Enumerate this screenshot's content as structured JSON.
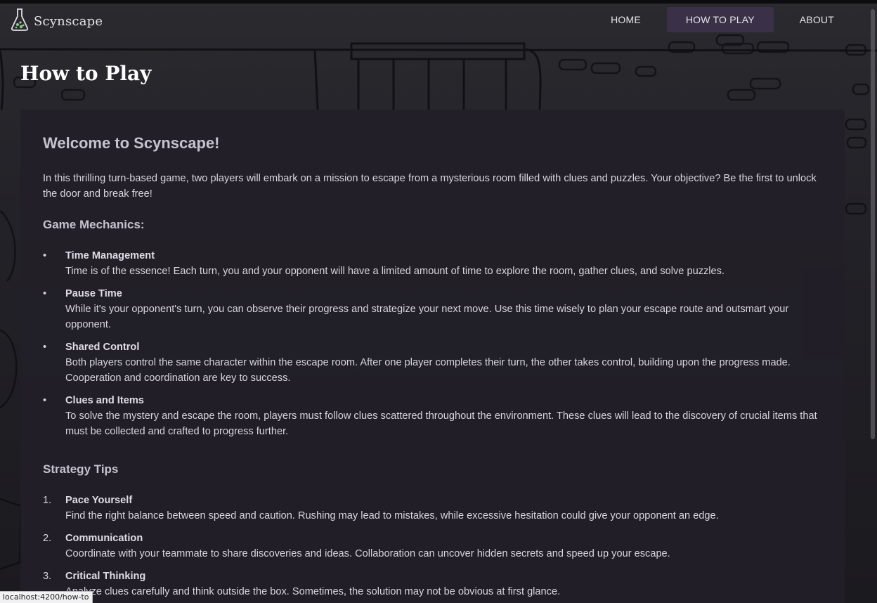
{
  "brand": {
    "name": "Scynscape",
    "icon": "flask-icon"
  },
  "nav": {
    "home": "HOME",
    "how_to_play": "HOW TO PLAY",
    "about": "ABOUT"
  },
  "page": {
    "title": "How to Play"
  },
  "content": {
    "heading": "Welcome to Scynscape!",
    "intro": "In this thrilling turn-based game, two players will embark on a mission to escape from a mysterious room filled with clues and puzzles. Your objective? Be the first to unlock the door and break free!",
    "mechanics_title": "Game Mechanics:",
    "mechanics": [
      {
        "bullet": "•",
        "title": "Time Management",
        "desc": "Time is of the essence! Each turn, you and your opponent will have a limited amount of time to explore the room, gather clues, and solve puzzles."
      },
      {
        "bullet": "•",
        "title": "Pause Time",
        "desc": "While it's your opponent's turn, you can observe their progress and strategize your next move. Use this time wisely to plan your escape route and outsmart your opponent."
      },
      {
        "bullet": "•",
        "title": "Shared Control",
        "desc": "Both players control the same character within the escape room. After one player completes their turn, the other takes control, building upon the progress made. Cooperation and coordination are key to success."
      },
      {
        "bullet": "•",
        "title": "Clues and Items",
        "desc": "To solve the mystery and escape the room, players must follow clues scattered throughout the environment. These clues will lead to the discovery of crucial items that must be collected and crafted to progress further."
      }
    ],
    "tips_title": "Strategy Tips",
    "tips": [
      {
        "num": "1.",
        "title": "Pace Yourself",
        "desc": "Find the right balance between speed and caution. Rushing may lead to mistakes, while excessive hesitation could give your opponent an edge."
      },
      {
        "num": "2.",
        "title": "Communication",
        "desc": "Coordinate with your teammate to share discoveries and ideas. Collaboration can uncover hidden secrets and speed up your escape."
      },
      {
        "num": "3.",
        "title": "Critical Thinking",
        "desc": "Analyze clues carefully and think outside the box. Sometimes, the solution may not be obvious at first glance."
      }
    ]
  },
  "status_bar": {
    "url": "localhost:4200/how-to"
  }
}
